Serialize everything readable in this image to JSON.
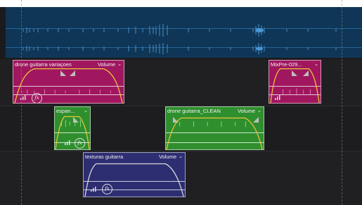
{
  "colors": {
    "background": "#1b1b1d",
    "audio_track": "#0f3656",
    "clip_pink": "#a0175f",
    "clip_green": "#2f8f2e",
    "clip_blue": "#2d2e72",
    "envelope": "#e8c53a"
  },
  "icons": [
    "chevron-down-icon",
    "fx-icon",
    "level-meter-icon",
    "fade-marker-icon"
  ],
  "clips": [
    {
      "name": "drone guitarra variaçoes",
      "menu_label": "Volume",
      "fx_label": "fx",
      "color": "pink"
    },
    {
      "name": "MixPre-029...",
      "menu_label": "",
      "fx_label": "",
      "color": "pink"
    },
    {
      "name": "espan...",
      "menu_label": "",
      "fx_label": "fx",
      "color": "green"
    },
    {
      "name": "drone guitarra_CLEAN",
      "menu_label": "Volume",
      "fx_label": "",
      "color": "green"
    },
    {
      "name": "texturas guitarra",
      "menu_label": "Volume",
      "fx_label": "fx",
      "color": "blue"
    }
  ]
}
